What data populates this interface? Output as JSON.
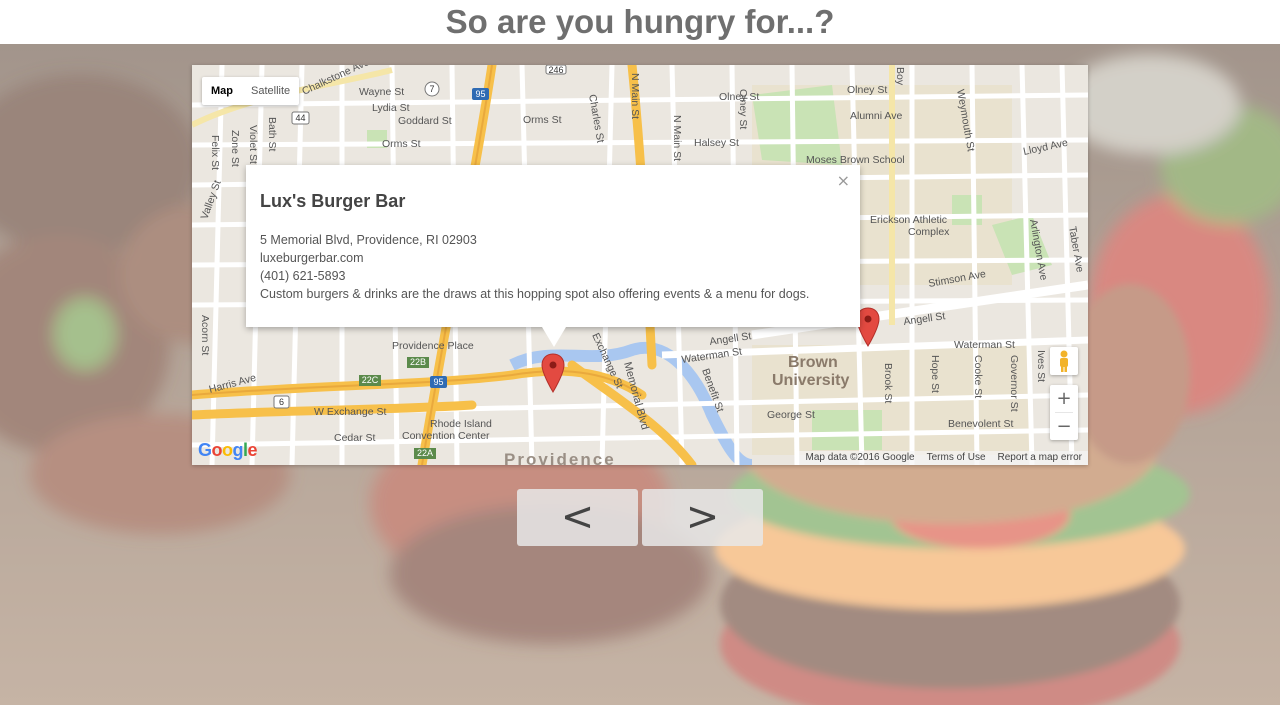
{
  "header": {
    "title": "So are you hungry for...?"
  },
  "map": {
    "map_type": {
      "map_label": "Map",
      "satellite_label": "Satellite"
    },
    "labels": {
      "charles_st": "Charles St",
      "n_main_st": "N Main St",
      "olney_st_1": "Olney St",
      "olney_st_2": "Olney St",
      "alumni_ave": "Alumni Ave",
      "halsey_st": "Halsey St",
      "orms_st_1": "Orms St",
      "orms_st_2": "Orms St",
      "wayne_st": "Wayne St",
      "lydia_st": "Lydia St",
      "goddard_st": "Goddard St",
      "chalkstone_ave": "Chalkstone Ave",
      "zone_st": "Zone St",
      "bath_st": "Bath St",
      "felix_st": "Felix St",
      "violet_st": "Violet St",
      "moses_brown": "Moses Brown School",
      "lloyd_ave": "Lloyd Ave",
      "erickson_1": "Erickson Athletic",
      "erickson_2": "Complex",
      "stimson_ave": "Stimson Ave",
      "angell_st_1": "Angell St",
      "angell_st_2": "Angell St",
      "waterman_st_1": "Waterman St",
      "waterman_st_2": "Waterman St",
      "brown_1": "Brown",
      "brown_2": "University",
      "george_st": "George St",
      "benevolent_st": "Benevolent St",
      "providence_place": "Providence Place",
      "harris_ave": "Harris Ave",
      "w_exchange_st": "W Exchange St",
      "cedar_st": "Cedar St",
      "ri_conv_1": "Rhode Island",
      "ri_conv_2": "Convention Center",
      "providence": "Providence",
      "memorial_blvd": "Memorial Blvd",
      "exchange_st": "Exchange St",
      "benefit_st": "Benefit St",
      "brook_st": "Brook St",
      "hope_st": "Hope St",
      "cooke_st": "Cooke St",
      "governor_st": "Governor St",
      "ives_st": "Ives St",
      "acorn_st": "Acorn St",
      "valley_st": "Valley St",
      "arlington_ave": "Arlington Ave",
      "taber_ave": "Taber Ave",
      "weymouth_st": "Weymouth St",
      "boylston": "Boy",
      "shield_95_1": "95",
      "shield_95_2": "95",
      "shield_44": "44",
      "shield_246": "246",
      "shield_6": "6",
      "shield_7": "7",
      "shield_22b": "22B",
      "shield_22c": "22C",
      "shield_22a": "22A"
    },
    "info_window": {
      "close_symbol": "×",
      "name": "Lux's Burger Bar",
      "address": "5 Memorial Blvd, Providence, RI 02903",
      "website": "luxeburgerbar.com",
      "phone": "(401) 621-5893",
      "description": "Custom burgers & drinks are the draws at this hopping spot also offering events & a menu for dogs."
    },
    "controls": {
      "zoom_in": "+",
      "zoom_out": "−"
    },
    "logo": {
      "g1": "G",
      "o1": "o",
      "o2": "o",
      "g2": "g",
      "l": "l",
      "e": "e"
    },
    "footer": {
      "map_data": "Map data ©2016 Google",
      "terms": "Terms of Use",
      "report": "Report a map error"
    },
    "colors": {
      "land": "#ebe7e0",
      "road": "#ffffff",
      "highway": "#f7c04a",
      "park": "#c9e3b5",
      "water": "#a9c7f0",
      "campus": "#e9e2cf",
      "marker": "#e34a41"
    }
  },
  "nav": {
    "prev_label": "<",
    "next_label": ">"
  },
  "background": {
    "icon": "burger-photo"
  }
}
